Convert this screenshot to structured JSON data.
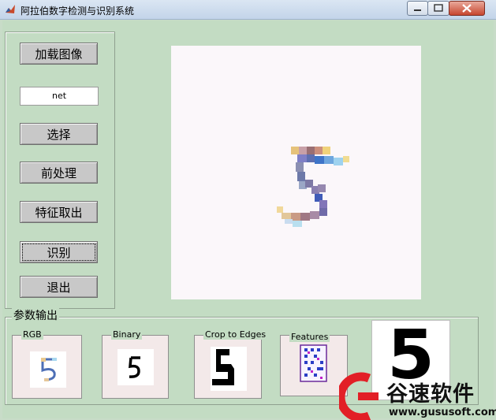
{
  "window": {
    "title": "阿拉伯数字检测与识别系统",
    "icon": "matlab-icon",
    "controls": [
      "minimize-icon",
      "maximize-icon",
      "close-icon"
    ]
  },
  "left_panel": {
    "buttons": {
      "load": "加载图像",
      "select": "选择",
      "preprocess": "前处理",
      "extract": "特征取出",
      "recognize": "识别",
      "exit": "退出"
    },
    "net_field": "net"
  },
  "main_display": {
    "content": "digit-5-pixelated"
  },
  "output_panel": {
    "title": "参数输出",
    "panels": {
      "rgb": "RGB",
      "binary": "Binary",
      "crop": "Crop to Edges",
      "features": "Features"
    },
    "result_digit": "5"
  },
  "watermark": {
    "brand": "谷速软件",
    "url": "www.gususoft.com",
    "logo": "gusu-logo-icon"
  },
  "colors": {
    "background": "#c3dcc3",
    "watermark_red": "#e21f26"
  }
}
